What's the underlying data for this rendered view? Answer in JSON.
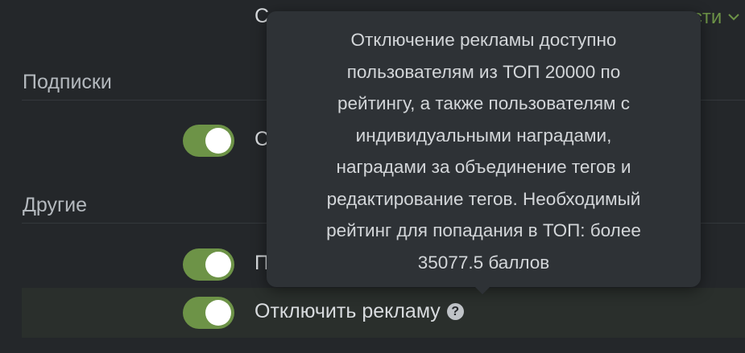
{
  "top_row": {
    "label_clip": "С",
    "link_clip": "сти",
    "link_chevron": "chevron-down-icon"
  },
  "sections": [
    {
      "title": "Подписки"
    },
    {
      "title": "Другие"
    }
  ],
  "rows": [
    {
      "label_clip": "С",
      "toggle_on": true
    },
    {
      "label_clip": "П",
      "toggle_on": true
    },
    {
      "label": "Отключить рекламу",
      "toggle_on": true,
      "help_glyph": "?"
    }
  ],
  "tooltip": {
    "text": "Отключение рекламы доступно\nпользователям из ТОП 20000 по\nрейтингу, а также пользователям с\nиндивидуальными наградами,\nнаградами за объединение тегов и\nредактирование тегов. Необходимый\nрейтинг для попадания в ТОП: более\n35077.5 баллов"
  },
  "colors": {
    "background": "#24272a",
    "toggle_on": "#6d9347",
    "tooltip_bg": "#2e3236"
  }
}
